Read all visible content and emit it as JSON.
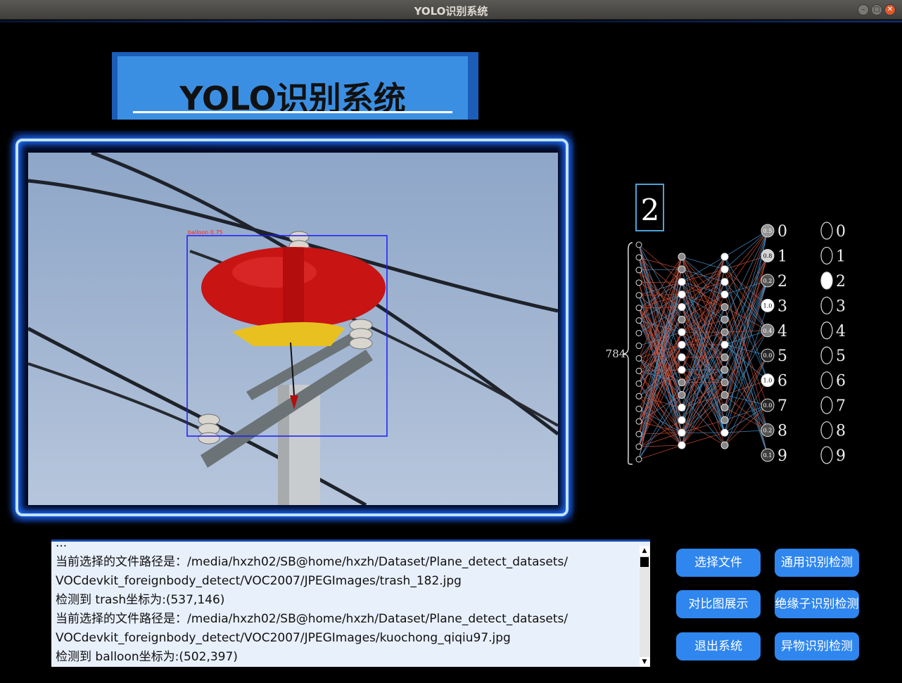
{
  "window": {
    "title": "YOLO识别系统",
    "min_icon": "minimize-icon",
    "max_icon": "maximize-icon",
    "close_icon": "close-icon"
  },
  "header": {
    "title": "YOLO识别系统"
  },
  "detection": {
    "label": "balloon 0.75",
    "box_color": "#1a1aff",
    "label_color": "#ff2020"
  },
  "network": {
    "input_digit": "2",
    "input_size": "784",
    "output_labels": [
      "0",
      "1",
      "2",
      "3",
      "4",
      "5",
      "6",
      "7",
      "8",
      "9"
    ],
    "output_values": [
      "0.5",
      "0.8",
      "0.2",
      "1.0",
      "0.4",
      "0.0",
      "1.0",
      "0.0",
      "0.2",
      "0.1"
    ],
    "predicted_index": 2
  },
  "log": {
    "lines": [
      "...",
      "当前选择的文件路径是：/media/hxzh02/SB@home/hxzh/Dataset/Plane_detect_datasets/",
      "VOCdevkit_foreignbody_detect/VOC2007/JPEGImages/trash_182.jpg",
      "检测到 trash坐标为:(537,146)",
      "当前选择的文件路径是：/media/hxzh02/SB@home/hxzh/Dataset/Plane_detect_datasets/",
      "VOCdevkit_foreignbody_detect/VOC2007/JPEGImages/kuochong_qiqiu97.jpg",
      "检测到 balloon坐标为:(502,397)"
    ]
  },
  "buttons": {
    "select_file": "选择文件",
    "general_detect": "通用识别检测",
    "compare_show": "对比图展示",
    "insulator_detect": "绝缘子识别检测",
    "exit_system": "退出系统",
    "foreign_detect": "异物识别检测"
  },
  "colors": {
    "accent_blue": "#2f86ee",
    "banner_blue": "#3b8fe3",
    "frame_glow": "#1e6cff"
  }
}
